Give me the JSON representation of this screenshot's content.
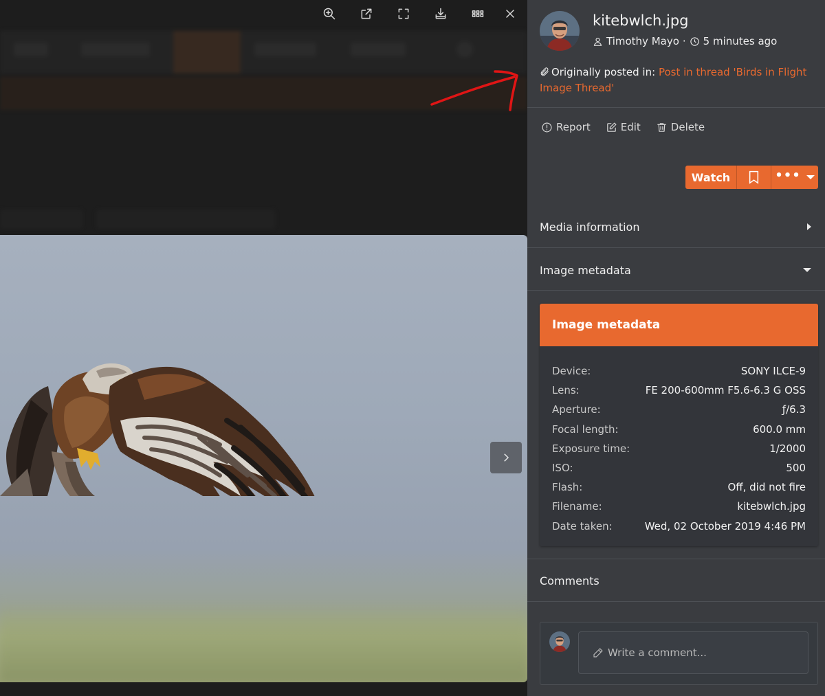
{
  "viewer": {
    "toolbar": [
      "zoom-in-icon",
      "open-external-icon",
      "fullscreen-icon",
      "download-icon",
      "thumbnails-icon",
      "close-icon"
    ],
    "next_icon": "chevron-right-icon"
  },
  "media": {
    "title": "kitebwlch.jpg",
    "author": "Timothy Mayo",
    "separator": "·",
    "time": "5 minutes ago",
    "origin_label": "Originally posted in:",
    "origin_link": "Post in thread 'Birds in Flight Image Thread'"
  },
  "actions": {
    "report": "Report",
    "edit": "Edit",
    "delete": "Delete"
  },
  "buttons": {
    "watch": "Watch",
    "more": "•••"
  },
  "sections": {
    "media_info": "Media information",
    "image_meta": "Image metadata",
    "comments": "Comments"
  },
  "metadata": {
    "header": "Image metadata",
    "rows": [
      {
        "k": "Device:",
        "v": "SONY ILCE-9"
      },
      {
        "k": "Lens:",
        "v": "FE 200-600mm F5.6-6.3 G OSS"
      },
      {
        "k": "Aperture:",
        "v": "ƒ/6.3"
      },
      {
        "k": "Focal length:",
        "v": "600.0 mm"
      },
      {
        "k": "Exposure time:",
        "v": "1/2000"
      },
      {
        "k": "ISO:",
        "v": "500"
      },
      {
        "k": "Flash:",
        "v": "Off, did not fire"
      },
      {
        "k": "Filename:",
        "v": "kitebwlch.jpg"
      },
      {
        "k": "Date taken:",
        "v": "Wed, 02 October 2019 4:46 PM"
      }
    ]
  },
  "comment": {
    "placeholder": "Write a comment..."
  },
  "colors": {
    "accent": "#e8692f",
    "sidebar_bg": "#3a3c40",
    "annotation": "#e01515"
  }
}
